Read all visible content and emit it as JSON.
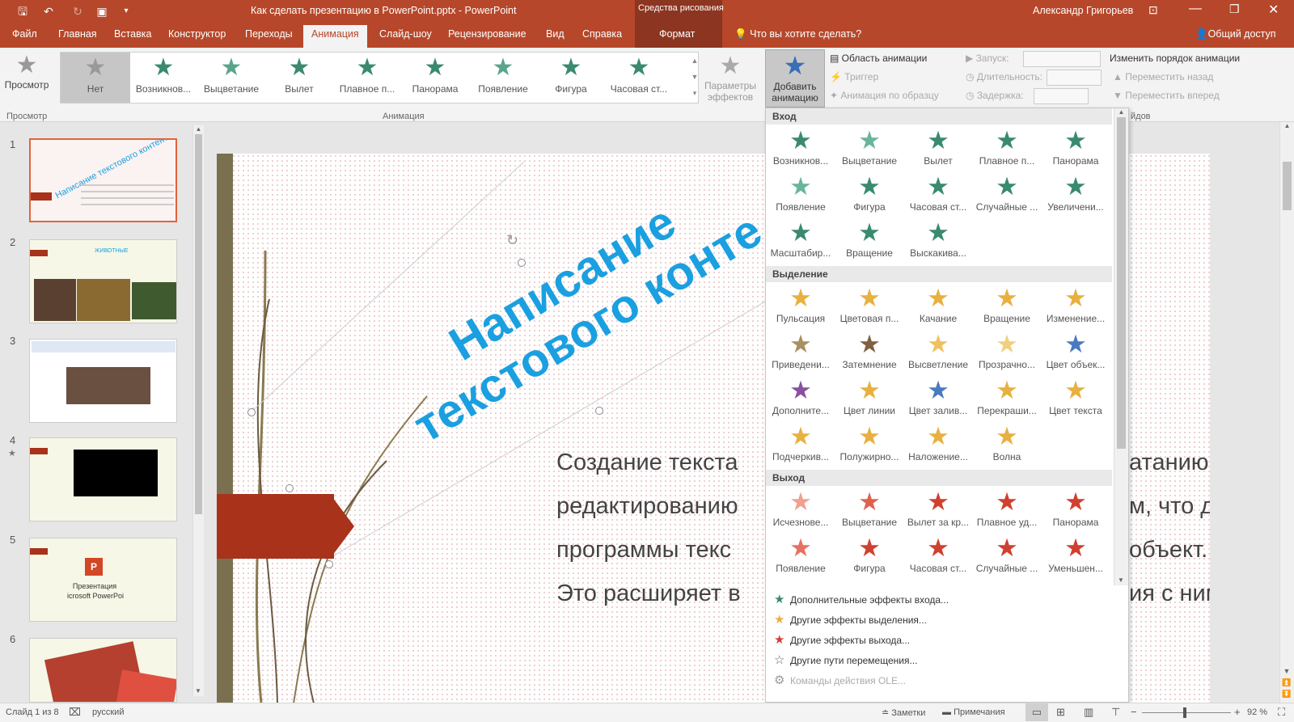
{
  "app": {
    "title": "Как сделать презентацию в PowerPoint.pptx - PowerPoint",
    "user": "Александр Григорьев",
    "drawing_tools": "Средства рисования",
    "share": "Общий доступ",
    "tell_me": "Что вы хотите сделать?"
  },
  "tabs": [
    "Файл",
    "Главная",
    "Вставка",
    "Конструктор",
    "Переходы",
    "Анимация",
    "Слайд-шоу",
    "Рецензирование",
    "Вид",
    "Справка",
    "Формат"
  ],
  "ribbon": {
    "preview": "Просмотр",
    "preview_group": "Просмотр",
    "anim_group": "Анимация",
    "effect_params": "Параметры эффектов",
    "gallery": [
      {
        "label": "Нет",
        "color": "#999999"
      },
      {
        "label": "Возникнов...",
        "color": "#3a8a6e"
      },
      {
        "label": "Выцветание",
        "color": "#5aa58a"
      },
      {
        "label": "Вылет",
        "color": "#3a8a6e"
      },
      {
        "label": "Плавное п...",
        "color": "#3a8a6e"
      },
      {
        "label": "Панорама",
        "color": "#3a8a6e"
      },
      {
        "label": "Появление",
        "color": "#5aa58a"
      },
      {
        "label": "Фигура",
        "color": "#3a8a6e"
      },
      {
        "label": "Часовая ст...",
        "color": "#3a8a6e"
      }
    ],
    "add_anim": "Добавить анимацию",
    "anim_pane": "Область анимации",
    "trigger": "Триггер",
    "anim_painter": "Анимация по образцу",
    "start": "Запуск:",
    "duration": "Длительность:",
    "delay": "Задержка:",
    "reorder": "Изменить порядок анимации",
    "move_back": "Переместить назад",
    "move_fwd": "Переместить вперед",
    "timing_frag": "йдов"
  },
  "thumbs": {
    "numbers": [
      "1",
      "2",
      "3",
      "4",
      "5",
      "6"
    ],
    "t1_title": "Написание текстового контента",
    "t2_title": "ЖИВОТНЫЕ",
    "t5_line1": "Презентация",
    "t5_line2": "icrosoft PowerPoi"
  },
  "slide": {
    "title_l1": "Написание",
    "title_l2": "текстового конте",
    "body": [
      "Создание текста",
      "редактированию",
      "программы текс",
      "Это расширяет в"
    ],
    "body_right": [
      "атанию и",
      "м, что для",
      "объект.",
      "ия с ним."
    ]
  },
  "dropdown": {
    "sections": [
      {
        "title": "Вход",
        "items": [
          {
            "label": "Возникнов...",
            "color": "#3a8a6e"
          },
          {
            "label": "Выцветание",
            "color": "#6ab59a"
          },
          {
            "label": "Вылет",
            "color": "#3a8a6e"
          },
          {
            "label": "Плавное п...",
            "color": "#3a8a6e"
          },
          {
            "label": "Панорама",
            "color": "#3a8a6e"
          },
          {
            "label": "Появление",
            "color": "#6ab59a"
          },
          {
            "label": "Фигура",
            "color": "#3a8a6e"
          },
          {
            "label": "Часовая ст...",
            "color": "#3a8a6e"
          },
          {
            "label": "Случайные ...",
            "color": "#3a8a6e"
          },
          {
            "label": "Увеличени...",
            "color": "#3a8a6e"
          },
          {
            "label": "Масштабир...",
            "color": "#3a8a6e"
          },
          {
            "label": "Вращение",
            "color": "#3a8a6e"
          },
          {
            "label": "Выскакива...",
            "color": "#3a8a6e"
          }
        ]
      },
      {
        "title": "Выделение",
        "items": [
          {
            "label": "Пульсация",
            "color": "#e8b040"
          },
          {
            "label": "Цветовая п...",
            "color": "#e8b040"
          },
          {
            "label": "Качание",
            "color": "#e8b040"
          },
          {
            "label": "Вращение",
            "color": "#e8b040"
          },
          {
            "label": "Изменение...",
            "color": "#e8b040"
          },
          {
            "label": "Приведени...",
            "color": "#a89060"
          },
          {
            "label": "Затемнение",
            "color": "#806040"
          },
          {
            "label": "Высветление",
            "color": "#f0c060"
          },
          {
            "label": "Прозрачно...",
            "color": "#f0d080"
          },
          {
            "label": "Цвет объек...",
            "color": "#4a7ac0"
          },
          {
            "label": "Дополните...",
            "color": "#8a50a0"
          },
          {
            "label": "Цвет линии",
            "color": "#e8b040"
          },
          {
            "label": "Цвет залив...",
            "color": "#4a7ac0"
          },
          {
            "label": "Перекраши...",
            "color": "#e8b040"
          },
          {
            "label": "Цвет текста",
            "color": "#e8b040"
          },
          {
            "label": "Подчеркив...",
            "color": "#e8b040"
          },
          {
            "label": "Полужирно...",
            "color": "#e8b040"
          },
          {
            "label": "Наложение...",
            "color": "#e8b040"
          },
          {
            "label": "Волна",
            "color": "#e8b040"
          }
        ]
      },
      {
        "title": "Выход",
        "items": [
          {
            "label": "Исчезнове...",
            "color": "#f0a090"
          },
          {
            "label": "Выцветание",
            "color": "#e06050"
          },
          {
            "label": "Вылет за кр...",
            "color": "#d04030"
          },
          {
            "label": "Плавное уд...",
            "color": "#d04030"
          },
          {
            "label": "Панорама",
            "color": "#d04030"
          },
          {
            "label": "Появление",
            "color": "#e87060"
          },
          {
            "label": "Фигура",
            "color": "#d04030"
          },
          {
            "label": "Часовая ст...",
            "color": "#d04030"
          },
          {
            "label": "Случайные ...",
            "color": "#d04030"
          },
          {
            "label": "Уменьшен...",
            "color": "#d04030"
          }
        ]
      }
    ],
    "more": [
      {
        "label": "Дополнительные эффекты входа...",
        "icon": "star",
        "color": "#3a8a6e"
      },
      {
        "label": "Другие эффекты выделения...",
        "icon": "star",
        "color": "#e8b040"
      },
      {
        "label": "Другие эффекты выхода...",
        "icon": "star",
        "color": "#d04030"
      },
      {
        "label": "Другие пути перемещения...",
        "icon": "star-outline",
        "color": "#666666"
      },
      {
        "label": "Команды действия OLE...",
        "icon": "gear",
        "color": "#999999"
      }
    ]
  },
  "status": {
    "slide": "Слайд 1 из 8",
    "lang": "русский",
    "notes": "Заметки",
    "comments": "Примечания",
    "zoom": "92 %",
    "minus": "−",
    "plus": "+"
  },
  "colors": {
    "accent": "#b7472a",
    "title_text": "#1aa0e0"
  }
}
